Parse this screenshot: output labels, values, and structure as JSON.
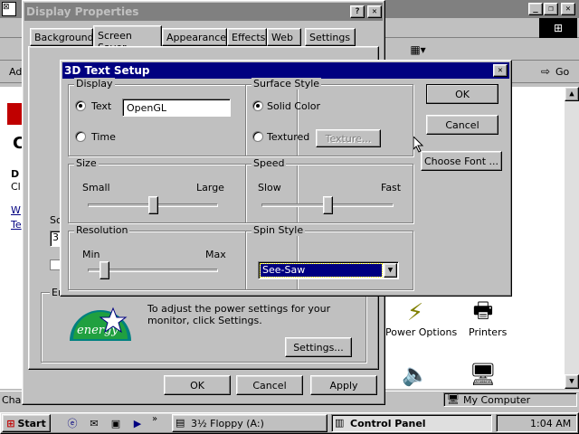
{
  "titlebar_left": {
    "title": "Display Properties"
  },
  "display_props": {
    "title": "Display Properties",
    "tabs": [
      "Background",
      "Screen Saver",
      "Appearance",
      "Effects",
      "Web",
      "Settings"
    ],
    "energy_text": "To adjust the power settings for your monitor, click Settings.",
    "settings_label": "Settings...",
    "ok_label": "OK",
    "cancel_label": "Cancel",
    "apply_label": "Apply",
    "partial_labels": [
      "Sc",
      "3",
      "En"
    ]
  },
  "explorer": {
    "go_label": "Go",
    "address_fragment": "Ad",
    "icons": [
      {
        "label": "Power Options"
      },
      {
        "label": "Printers"
      }
    ],
    "status_left": "Cha",
    "status_right": "My Computer",
    "sidebar_fragments": [
      "C",
      "D",
      "Cl",
      "W",
      "Te"
    ]
  },
  "dialog": {
    "title": "3D Text Setup",
    "display": {
      "label": "Display",
      "text_option": "Text",
      "text_value": "OpenGL",
      "time_option": "Time",
      "selected": "text"
    },
    "surface": {
      "label": "Surface Style",
      "solid_option": "Solid Color",
      "textured_option": "Textured",
      "texture_button": "Texture...",
      "selected": "solid"
    },
    "size": {
      "label": "Size",
      "min": "Small",
      "max": "Large",
      "value": 0.5
    },
    "speed": {
      "label": "Speed",
      "min": "Slow",
      "max": "Fast",
      "value": 0.5
    },
    "resolution": {
      "label": "Resolution",
      "min": "Min",
      "max": "Max",
      "value": 0.1
    },
    "spin": {
      "label": "Spin Style",
      "selected": "See-Saw"
    },
    "ok_label": "OK",
    "cancel_label": "Cancel",
    "font_label": "Choose Font ..."
  },
  "taskbar": {
    "start_label": "Start",
    "tasks": [
      {
        "label": "3½ Floppy (A:)"
      },
      {
        "label": "Control Panel"
      }
    ],
    "clock": "1:04 AM"
  },
  "colors": {
    "title_active": "#000080",
    "title_inactive": "#808080",
    "face": "#c0c0c0",
    "desktop": "#008080"
  }
}
